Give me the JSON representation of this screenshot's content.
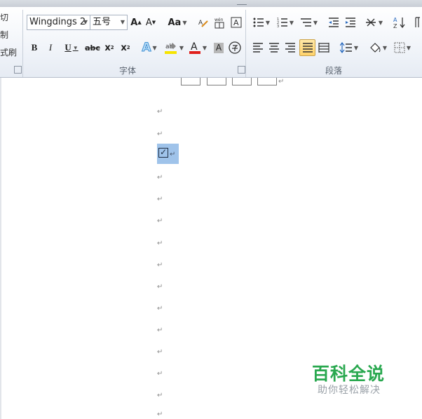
{
  "clipboard": {
    "cut_label": "切",
    "copy_label": "制",
    "format_painter_label": "式刷"
  },
  "font": {
    "font_name": "Wingdings 2",
    "font_size": "五号",
    "group_label": "字体"
  },
  "paragraph": {
    "group_label": "段落"
  },
  "watermark": {
    "main": "百科全说",
    "sub": "助你轻松解决"
  },
  "document": {
    "paragraph_mark": "↵",
    "checkbox_char": "✓"
  },
  "colors": {
    "highlight": "#f6e400",
    "font_color": "#e0201c",
    "selection": "#9fc3ea",
    "watermark": "#29a84f"
  }
}
